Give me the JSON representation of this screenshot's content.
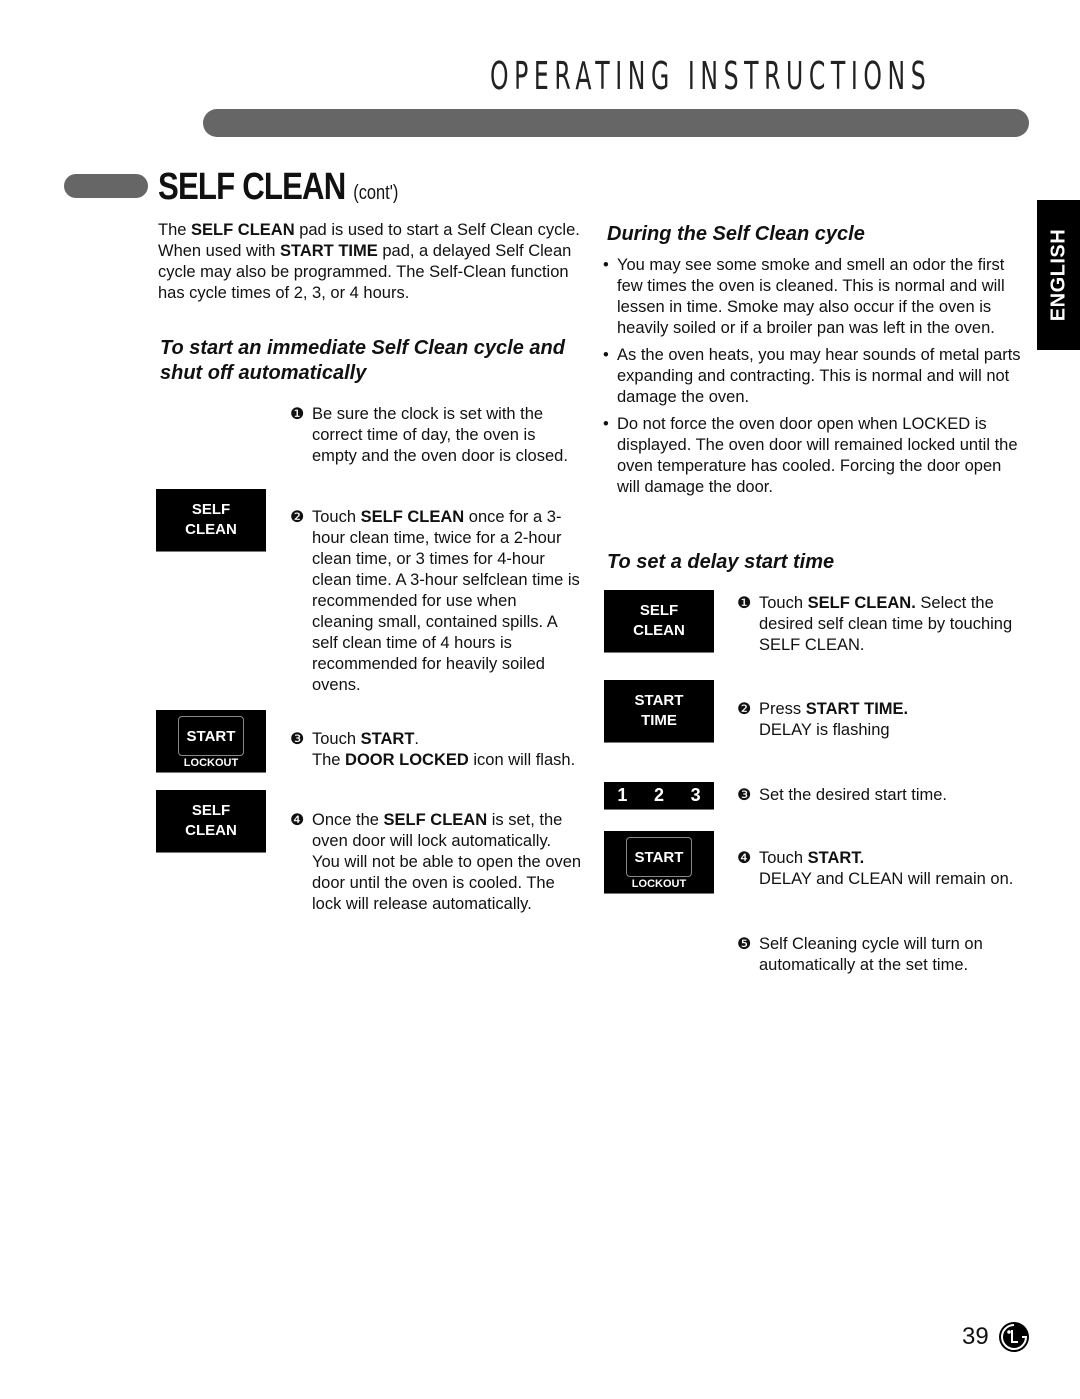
{
  "header": {
    "title": "OPERATING INSTRUCTIONS"
  },
  "section": {
    "title": "SELF CLEAN",
    "subtitle": "(cont')"
  },
  "language_tab": "ENGLISH",
  "intro": {
    "p1": "The ",
    "b1": "SELF CLEAN",
    "p2": " pad is used to start a Self Clean cycle. When used with ",
    "b2": "START TIME",
    "p3": " pad, a delayed Self Clean cycle may also be programmed. The Self-Clean function has cycle times of 2, 3, or 4 hours."
  },
  "immediate": {
    "heading": "To start an immediate Self Clean cycle and shut off automatically",
    "steps": [
      {
        "num": "❶",
        "text": "Be sure the clock is set with the correct time of day, the oven is empty and the oven door is closed."
      },
      {
        "num": "❷",
        "pre": "Touch ",
        "bold": "SELF CLEAN",
        "post": " once for a 3-hour clean time, twice for a 2-hour clean time, or 3 times for 4-hour clean time. A 3-hour selfclean time is recommended for use when cleaning small, contained spills. A self clean time of 4 hours is recommended for heavily soiled ovens."
      },
      {
        "num": "❸",
        "pre": "Touch ",
        "bold": "START",
        "post": ".",
        "line2_pre": "The ",
        "line2_bold": "DOOR LOCKED",
        "line2_post": " icon will flash."
      },
      {
        "num": "❹",
        "pre": "Once the ",
        "bold": "SELF CLEAN",
        "post": " is set, the oven door will lock automatically. You will not be able to open the oven door until the oven is cooled. The lock will release automatically."
      }
    ]
  },
  "pads": {
    "self_clean_l1": "SELF",
    "self_clean_l2": "CLEAN",
    "start": "START",
    "lockout": "LOCKOUT",
    "start_time_l1": "START",
    "start_time_l2": "TIME",
    "numbers": [
      "1",
      "2",
      "3"
    ]
  },
  "during": {
    "heading": "During the Self Clean cycle",
    "bullets": [
      "You may see some smoke and smell an odor the first few times the oven is cleaned. This is normal and will lessen in time. Smoke may also occur if the oven is heavily soiled or if a broiler pan was left in the oven.",
      "As the oven heats, you may hear sounds of metal parts expanding and contracting. This is normal and will not damage the oven.",
      "Do not force the oven door open when LOCKED is displayed. The oven door will remained locked until the oven temperature has cooled. Forcing the door open will damage the door."
    ]
  },
  "delay": {
    "heading": "To set a delay start time",
    "steps": [
      {
        "num": "❶",
        "pre": "Touch ",
        "bold": "SELF CLEAN.",
        "post": " Select the desired self clean time by touching SELF CLEAN."
      },
      {
        "num": "❷",
        "pre": "Press ",
        "bold": "START TIME.",
        "line2": "DELAY is flashing"
      },
      {
        "num": "❸",
        "text": "Set the desired start time."
      },
      {
        "num": "❹",
        "pre": "Touch ",
        "bold": "START.",
        "line2": "DELAY and CLEAN will remain on."
      },
      {
        "num": "❺",
        "text": "Self Cleaning cycle will turn on automatically at the set time."
      }
    ]
  },
  "footer": {
    "page_number": "39",
    "logo": "lg-logo"
  }
}
